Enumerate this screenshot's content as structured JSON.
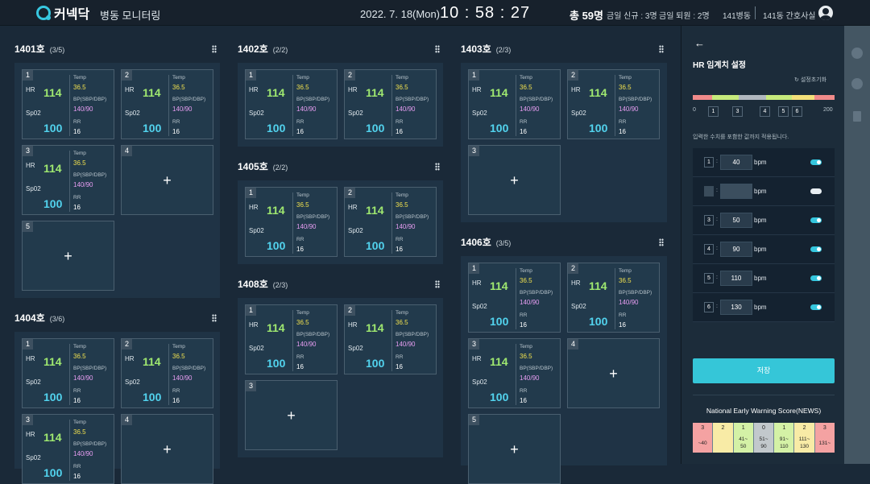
{
  "header": {
    "logo_text": "커넥닥",
    "app_title": "병동 모니터링",
    "date": "2022. 7. 18(Mon)",
    "time": "10 : 58 : 27",
    "total": "총 59명",
    "admit": "금일 신규 : 3명",
    "discharge": "금일 퇴원 : 2명",
    "ward": "141병동",
    "station": "141동 간호사실"
  },
  "vitals_labels": {
    "hr": "HR",
    "sp": "Sp02",
    "temp": "Temp",
    "bp": "BP(SBP/DBP)",
    "rr": "RR"
  },
  "bed_values": {
    "hr": "114",
    "sp": "100",
    "temp": "36.5",
    "bp": "140/90",
    "rr": "16"
  },
  "rooms": [
    {
      "name": "1401호",
      "count": "(3/5)"
    },
    {
      "name": "1402호",
      "count": "(2/2)"
    },
    {
      "name": "1403호",
      "count": "(2/3)"
    },
    {
      "name": "1405호",
      "count": "(2/2)"
    },
    {
      "name": "1406호",
      "count": "(3/5)"
    },
    {
      "name": "1408호",
      "count": "(2/3)"
    },
    {
      "name": "1404호",
      "count": "(3/6)"
    }
  ],
  "bed_numbers": [
    "1",
    "2",
    "3",
    "4",
    "5"
  ],
  "plus": "+",
  "panel": {
    "title": "HR 임계치 설정",
    "reset": "설정초기화",
    "hint": "입력한 수치를 포함한 값까지 적용됩니다.",
    "save": "저장",
    "scale": {
      "min": "0",
      "max": "200",
      "markers": [
        "1",
        "3",
        "4",
        "5",
        "6"
      ]
    },
    "bar_colors": [
      "#f08a8a",
      "#c6ea7c",
      "#b0b8bf",
      "#c6ea7c",
      "#f3e07a",
      "#f08a8a"
    ],
    "thresholds": [
      {
        "idx": "1",
        "value": "40",
        "unit": "bpm",
        "on": true
      },
      {
        "idx": "2",
        "value": "",
        "unit": "bpm",
        "on": false
      },
      {
        "idx": "3",
        "value": "50",
        "unit": "bpm",
        "on": true
      },
      {
        "idx": "4",
        "value": "90",
        "unit": "bpm",
        "on": true
      },
      {
        "idx": "5",
        "value": "110",
        "unit": "bpm",
        "on": true
      },
      {
        "idx": "6",
        "value": "130",
        "unit": "bpm",
        "on": true
      }
    ],
    "news_title": "National Early Warning Score(NEWS)",
    "news": [
      {
        "score": "3",
        "range": "~40",
        "color": "#f4a2a2"
      },
      {
        "score": "2",
        "range": "",
        "color": "#f8eba6"
      },
      {
        "score": "1",
        "range": "41~\n50",
        "color": "#d4f1a6"
      },
      {
        "score": "0",
        "range": "51~\n90",
        "color": "#c2c8cc"
      },
      {
        "score": "1",
        "range": "91~\n110",
        "color": "#d4f1a6"
      },
      {
        "score": "2",
        "range": "111~\n130",
        "color": "#f8eba6"
      },
      {
        "score": "3",
        "range": "131~",
        "color": "#f4a2a2"
      }
    ]
  }
}
